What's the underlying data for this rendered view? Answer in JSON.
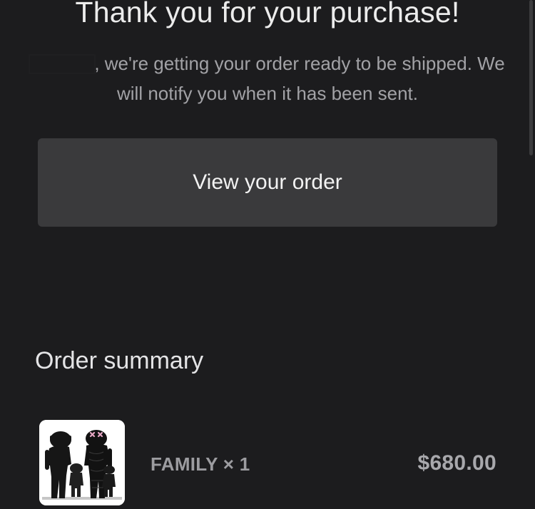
{
  "confirmation": {
    "title": "Thank you for your purchase!",
    "message": ", we're getting your order ready to be shipped. We will notify you when it has been sent.",
    "view_order_label": "View your order"
  },
  "order_summary": {
    "heading": "Order summary",
    "items": [
      {
        "name": "FAMILY × 1",
        "price": "$680.00",
        "thumbnail_icon": "kaws-family-figure-thumbnail"
      }
    ]
  }
}
